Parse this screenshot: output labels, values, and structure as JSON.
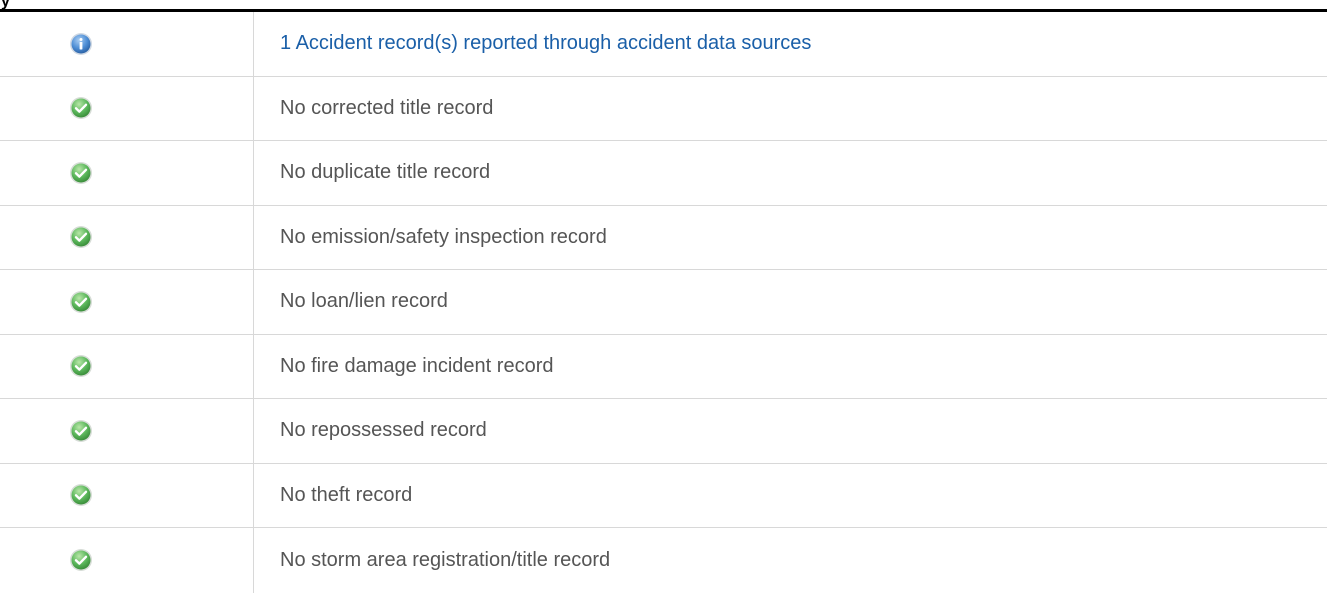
{
  "header": {
    "fragment": "y"
  },
  "colors": {
    "rule": "#000000",
    "text": "#555555",
    "link": "#1a5fa8",
    "divider": "#d8d8d8",
    "check_green": "#5cb85c",
    "info_blue": "#3f7fc7"
  },
  "records": [
    {
      "icon": "info-icon",
      "text": "1 Accident record(s) reported through accident data sources",
      "is_link": true
    },
    {
      "icon": "check-icon",
      "text": "No corrected title record",
      "is_link": false
    },
    {
      "icon": "check-icon",
      "text": "No duplicate title record",
      "is_link": false
    },
    {
      "icon": "check-icon",
      "text": "No emission/safety inspection record",
      "is_link": false
    },
    {
      "icon": "check-icon",
      "text": "No loan/lien record",
      "is_link": false
    },
    {
      "icon": "check-icon",
      "text": "No fire damage incident record",
      "is_link": false
    },
    {
      "icon": "check-icon",
      "text": "No repossessed record",
      "is_link": false
    },
    {
      "icon": "check-icon",
      "text": "No theft record",
      "is_link": false
    },
    {
      "icon": "check-icon",
      "text": "No storm area registration/title record",
      "is_link": false
    }
  ]
}
